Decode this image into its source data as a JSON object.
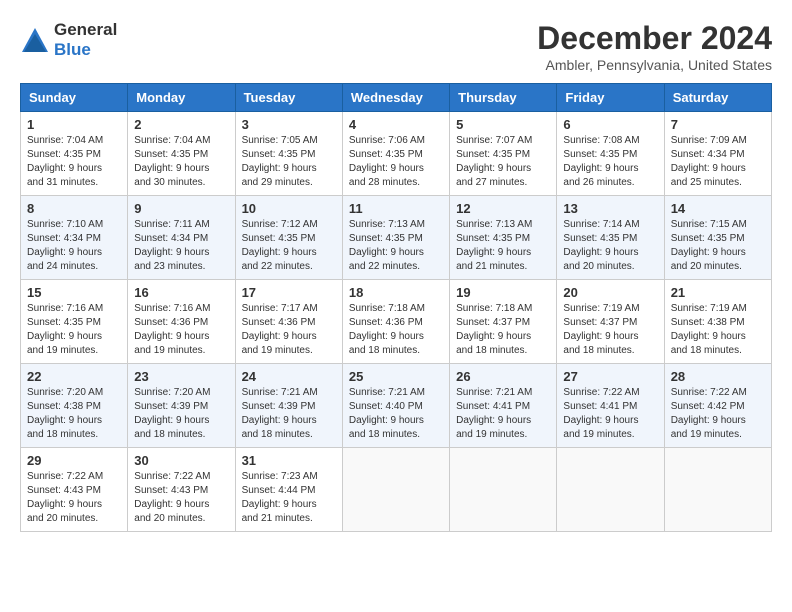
{
  "header": {
    "logo_general": "General",
    "logo_blue": "Blue",
    "title": "December 2024",
    "location": "Ambler, Pennsylvania, United States"
  },
  "weekdays": [
    "Sunday",
    "Monday",
    "Tuesday",
    "Wednesday",
    "Thursday",
    "Friday",
    "Saturday"
  ],
  "weeks": [
    [
      {
        "day": "1",
        "sunrise": "7:04 AM",
        "sunset": "4:35 PM",
        "daylight": "9 hours and 31 minutes."
      },
      {
        "day": "2",
        "sunrise": "7:04 AM",
        "sunset": "4:35 PM",
        "daylight": "9 hours and 30 minutes."
      },
      {
        "day": "3",
        "sunrise": "7:05 AM",
        "sunset": "4:35 PM",
        "daylight": "9 hours and 29 minutes."
      },
      {
        "day": "4",
        "sunrise": "7:06 AM",
        "sunset": "4:35 PM",
        "daylight": "9 hours and 28 minutes."
      },
      {
        "day": "5",
        "sunrise": "7:07 AM",
        "sunset": "4:35 PM",
        "daylight": "9 hours and 27 minutes."
      },
      {
        "day": "6",
        "sunrise": "7:08 AM",
        "sunset": "4:35 PM",
        "daylight": "9 hours and 26 minutes."
      },
      {
        "day": "7",
        "sunrise": "7:09 AM",
        "sunset": "4:34 PM",
        "daylight": "9 hours and 25 minutes."
      }
    ],
    [
      {
        "day": "8",
        "sunrise": "7:10 AM",
        "sunset": "4:34 PM",
        "daylight": "9 hours and 24 minutes."
      },
      {
        "day": "9",
        "sunrise": "7:11 AM",
        "sunset": "4:34 PM",
        "daylight": "9 hours and 23 minutes."
      },
      {
        "day": "10",
        "sunrise": "7:12 AM",
        "sunset": "4:35 PM",
        "daylight": "9 hours and 22 minutes."
      },
      {
        "day": "11",
        "sunrise": "7:13 AM",
        "sunset": "4:35 PM",
        "daylight": "9 hours and 22 minutes."
      },
      {
        "day": "12",
        "sunrise": "7:13 AM",
        "sunset": "4:35 PM",
        "daylight": "9 hours and 21 minutes."
      },
      {
        "day": "13",
        "sunrise": "7:14 AM",
        "sunset": "4:35 PM",
        "daylight": "9 hours and 20 minutes."
      },
      {
        "day": "14",
        "sunrise": "7:15 AM",
        "sunset": "4:35 PM",
        "daylight": "9 hours and 20 minutes."
      }
    ],
    [
      {
        "day": "15",
        "sunrise": "7:16 AM",
        "sunset": "4:35 PM",
        "daylight": "9 hours and 19 minutes."
      },
      {
        "day": "16",
        "sunrise": "7:16 AM",
        "sunset": "4:36 PM",
        "daylight": "9 hours and 19 minutes."
      },
      {
        "day": "17",
        "sunrise": "7:17 AM",
        "sunset": "4:36 PM",
        "daylight": "9 hours and 19 minutes."
      },
      {
        "day": "18",
        "sunrise": "7:18 AM",
        "sunset": "4:36 PM",
        "daylight": "9 hours and 18 minutes."
      },
      {
        "day": "19",
        "sunrise": "7:18 AM",
        "sunset": "4:37 PM",
        "daylight": "9 hours and 18 minutes."
      },
      {
        "day": "20",
        "sunrise": "7:19 AM",
        "sunset": "4:37 PM",
        "daylight": "9 hours and 18 minutes."
      },
      {
        "day": "21",
        "sunrise": "7:19 AM",
        "sunset": "4:38 PM",
        "daylight": "9 hours and 18 minutes."
      }
    ],
    [
      {
        "day": "22",
        "sunrise": "7:20 AM",
        "sunset": "4:38 PM",
        "daylight": "9 hours and 18 minutes."
      },
      {
        "day": "23",
        "sunrise": "7:20 AM",
        "sunset": "4:39 PM",
        "daylight": "9 hours and 18 minutes."
      },
      {
        "day": "24",
        "sunrise": "7:21 AM",
        "sunset": "4:39 PM",
        "daylight": "9 hours and 18 minutes."
      },
      {
        "day": "25",
        "sunrise": "7:21 AM",
        "sunset": "4:40 PM",
        "daylight": "9 hours and 18 minutes."
      },
      {
        "day": "26",
        "sunrise": "7:21 AM",
        "sunset": "4:41 PM",
        "daylight": "9 hours and 19 minutes."
      },
      {
        "day": "27",
        "sunrise": "7:22 AM",
        "sunset": "4:41 PM",
        "daylight": "9 hours and 19 minutes."
      },
      {
        "day": "28",
        "sunrise": "7:22 AM",
        "sunset": "4:42 PM",
        "daylight": "9 hours and 19 minutes."
      }
    ],
    [
      {
        "day": "29",
        "sunrise": "7:22 AM",
        "sunset": "4:43 PM",
        "daylight": "9 hours and 20 minutes."
      },
      {
        "day": "30",
        "sunrise": "7:22 AM",
        "sunset": "4:43 PM",
        "daylight": "9 hours and 20 minutes."
      },
      {
        "day": "31",
        "sunrise": "7:23 AM",
        "sunset": "4:44 PM",
        "daylight": "9 hours and 21 minutes."
      },
      null,
      null,
      null,
      null
    ]
  ]
}
